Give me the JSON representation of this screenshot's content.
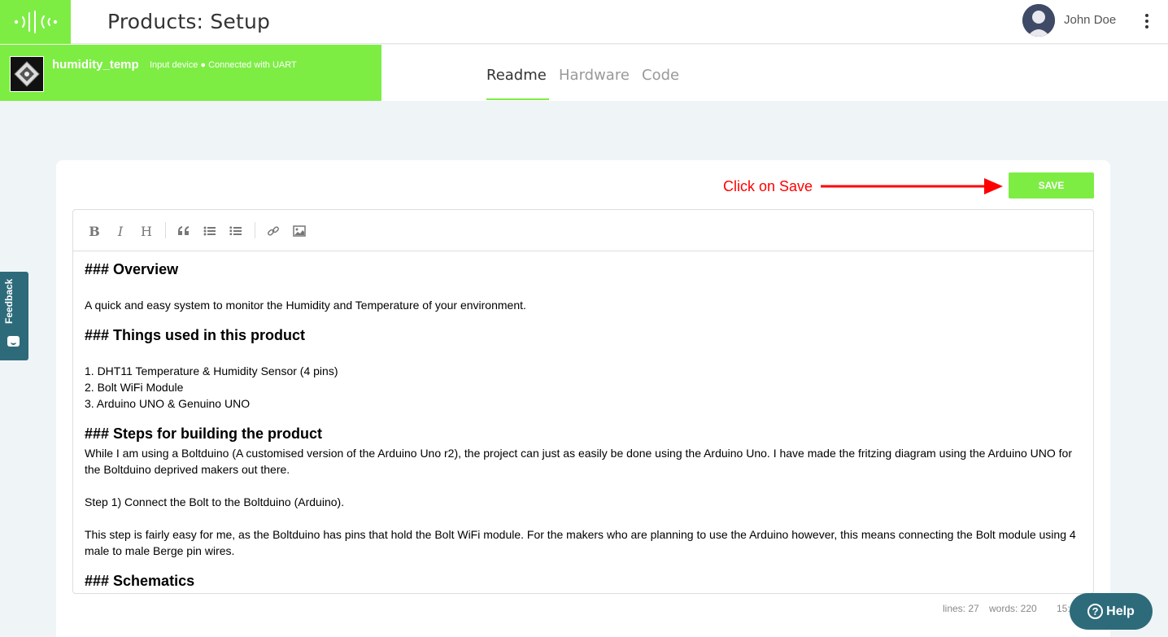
{
  "header": {
    "title": "Products: Setup",
    "user_name": "John Doe"
  },
  "device": {
    "name": "humidity_temp",
    "meta": "Input device ● Connected with UART"
  },
  "tabs": [
    {
      "label": "Readme",
      "active": true
    },
    {
      "label": "Hardware",
      "active": false
    },
    {
      "label": "Code",
      "active": false
    }
  ],
  "feedback": {
    "label": "Feedback"
  },
  "annotation": {
    "text": "Click on Save",
    "color": "#ff0000"
  },
  "save_button": {
    "label": "SAVE"
  },
  "toolbar": {
    "buttons": [
      "B",
      "I",
      "H",
      "quote-icon",
      "unordered-list-icon",
      "ordered-list-icon",
      "link-icon",
      "image-icon"
    ]
  },
  "content": {
    "h1": "### Overview",
    "p1": "A quick and easy system to monitor the Humidity and Temperature of your environment.",
    "h2": "### Things used in this product",
    "li1": "1.  DHT11 Temperature & Humidity Sensor (4 pins)",
    "li2": "2.  Bolt WiFi Module",
    "li3": "3.  Arduino UNO & Genuino UNO",
    "h3": "### Steps for building the product",
    "p2": "While I am using a Boltduino (A customised version of the Arduino Uno r2), the project can just as easily be done using the Arduino Uno. I have made the fritzing diagram using the Arduino UNO for the Boltduino deprived makers out there.",
    "p3": "Step 1) Connect the Bolt to the Boltduino (Arduino).",
    "p4": "This step is fairly easy for me, as the Boltduino has pins that hold the Bolt WiFi module. For the makers who are planning to use the Arduino however, this means connecting the Bolt module using 4 male to male Berge pin wires.",
    "h4": "### Schematics"
  },
  "status": {
    "lines": "lines: 27",
    "words": "words: 220",
    "cursor": "15:"
  },
  "help": {
    "label": "Help"
  },
  "colors": {
    "brand_green": "#7ded44",
    "teal": "#2d6b7b",
    "annotation_red": "#ff0000"
  }
}
